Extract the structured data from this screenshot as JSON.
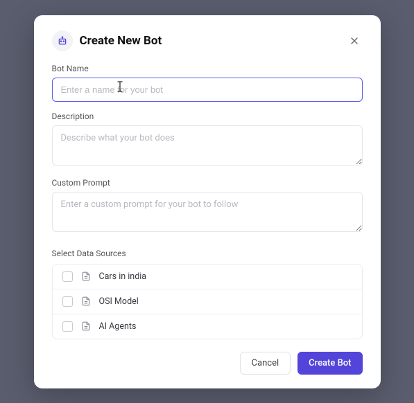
{
  "modal": {
    "title": "Create New Bot",
    "fields": {
      "botName": {
        "label": "Bot Name",
        "placeholder": "Enter a name for your bot",
        "value": ""
      },
      "description": {
        "label": "Description",
        "placeholder": "Describe what your bot does",
        "value": ""
      },
      "customPrompt": {
        "label": "Custom Prompt",
        "placeholder": "Enter a custom prompt for your bot to follow",
        "value": ""
      }
    },
    "dataSources": {
      "label": "Select Data Sources",
      "items": [
        {
          "label": "Cars in india",
          "checked": false
        },
        {
          "label": "OSI Model",
          "checked": false
        },
        {
          "label": "AI Agents",
          "checked": false
        }
      ]
    },
    "buttons": {
      "cancel": "Cancel",
      "create": "Create Bot"
    }
  }
}
